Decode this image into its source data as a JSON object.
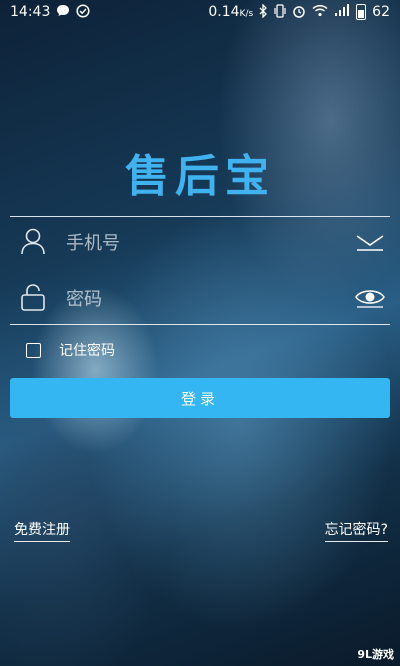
{
  "status_bar": {
    "time": "14:43",
    "speed": "0.14",
    "speed_unit": "K/s",
    "battery": "62",
    "icons": [
      "message-icon",
      "check-circle-icon",
      "bluetooth-icon",
      "vibrate-icon",
      "alarm-icon",
      "wifi-icon",
      "signal-icon",
      "battery-icon"
    ]
  },
  "app": {
    "title": "售后宝"
  },
  "form": {
    "phone_placeholder": "手机号",
    "password_placeholder": "密码",
    "remember_label": "记住密码",
    "login_label": "登录"
  },
  "links": {
    "register": "免费注册",
    "forgot": "忘记密码?"
  },
  "watermark": "9L游戏",
  "colors": {
    "accent": "#33b6f2",
    "title": "#3fb2ef"
  }
}
